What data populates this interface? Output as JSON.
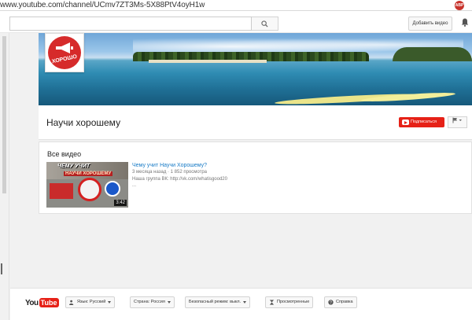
{
  "browser": {
    "url": "www.youtube.com/channel/UCmv7ZT3Ms-5X88PtV4oyH1w",
    "extension_label": "ABP"
  },
  "masthead": {
    "search_placeholder": "",
    "search_icon": "search-icon",
    "upload_label": "Добавить видео",
    "notifications_icon": "bell-icon"
  },
  "channel": {
    "avatar_text": "ХОРОШО",
    "title": "Научи хорошему",
    "subscribe_label": "Подписаться",
    "flag_icon": "flag-icon",
    "accent_color": "#e62117"
  },
  "videos_section": {
    "title": "Все видео",
    "items": [
      {
        "title": "Чему учит Научи Хорошему?",
        "meta": "3 месяца назад · 1 852 просмотра",
        "description": "Наша группа ВК: http://vk.com/whatisgood20",
        "more": "...",
        "duration": "3:42",
        "thumb_line1": "ЧЕМУ УЧИТ",
        "thumb_line2": "НАУЧИ ХОРОШЕМУ"
      }
    ]
  },
  "footer": {
    "logo_you": "You",
    "logo_tube": "Tube",
    "language": "Язык: Русский",
    "country": "Страна: Россия",
    "safety": "Безопасный режим: выкл.",
    "history": "Просмотренные",
    "help": "Справка"
  }
}
